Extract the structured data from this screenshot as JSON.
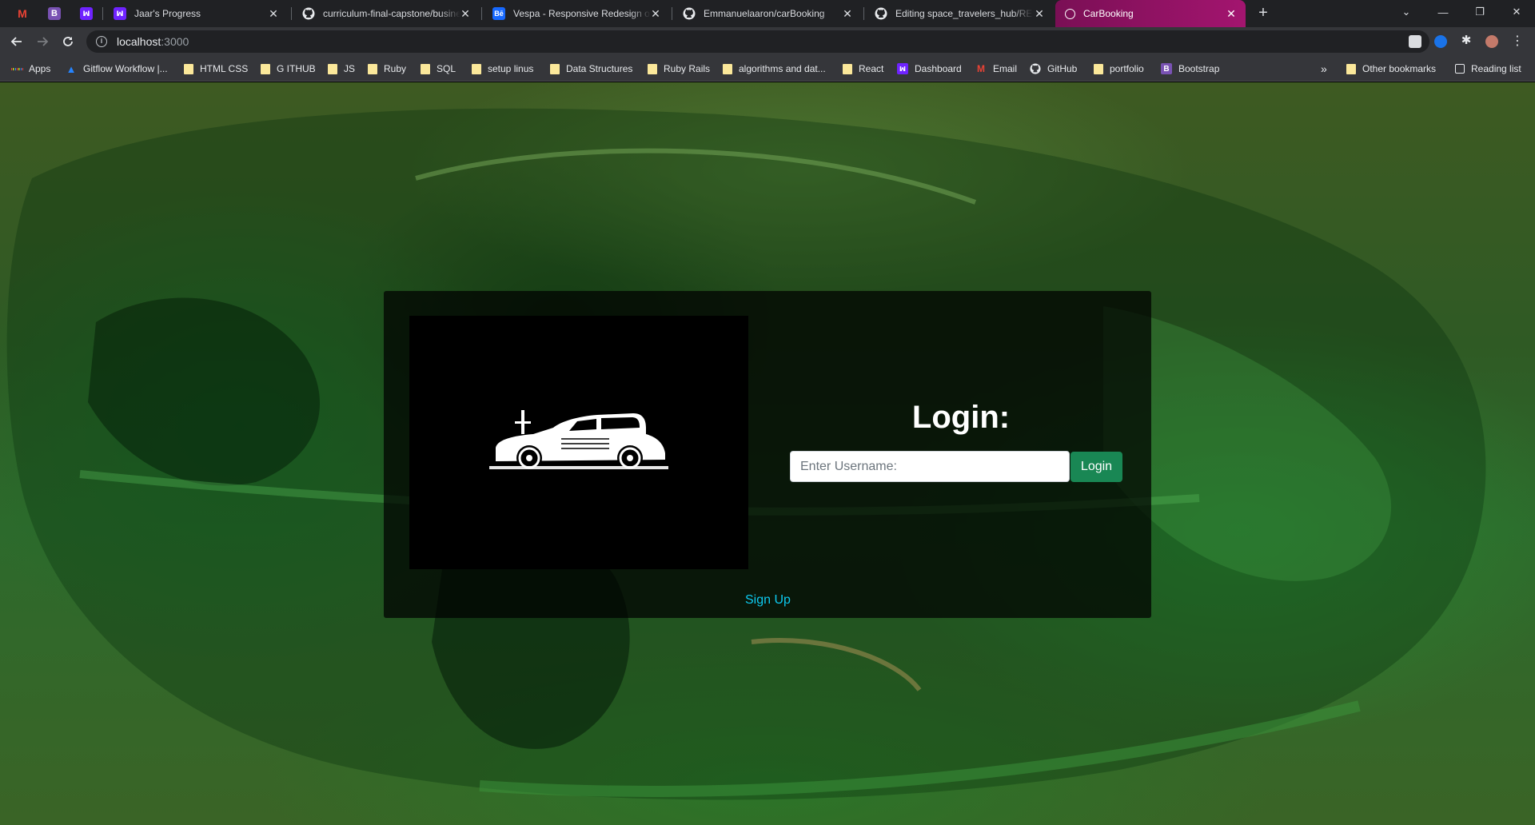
{
  "browser": {
    "tabs": [
      {
        "label": "",
        "favicon": "gmail-icon",
        "pinned": true
      },
      {
        "label": "",
        "favicon": "bootstrap-icon",
        "pinned": true
      },
      {
        "label": "",
        "favicon": "microverse-icon",
        "pinned": true
      },
      {
        "label": "Jaar's Progress",
        "favicon": "microverse-icon"
      },
      {
        "label": "curriculum-final-capstone/busine",
        "favicon": "github-icon"
      },
      {
        "label": "Vespa - Responsive Redesign on",
        "favicon": "behance-icon"
      },
      {
        "label": "Emmanuelaaron/carBooking",
        "favicon": "github-icon"
      },
      {
        "label": "Editing space_travelers_hub/REA",
        "favicon": "github-icon"
      },
      {
        "label": "CarBooking",
        "favicon": "globe-icon",
        "active": true
      }
    ],
    "address": {
      "host": "localhost",
      "port": ":3000"
    },
    "bookmarks": [
      {
        "label": "Apps",
        "icon": "apps-grid-icon"
      },
      {
        "label": "Gitflow Workflow |...",
        "icon": "atlassian-icon"
      },
      {
        "label": "HTML CSS",
        "icon": "folder-icon"
      },
      {
        "label": "G ITHUB",
        "icon": "folder-icon"
      },
      {
        "label": "JS",
        "icon": "folder-icon"
      },
      {
        "label": "Ruby",
        "icon": "folder-icon"
      },
      {
        "label": "SQL",
        "icon": "folder-icon"
      },
      {
        "label": "setup linus",
        "icon": "folder-icon"
      },
      {
        "label": "Data Structures",
        "icon": "folder-icon"
      },
      {
        "label": "Ruby Rails",
        "icon": "folder-icon"
      },
      {
        "label": "algorithms and dat...",
        "icon": "folder-icon"
      },
      {
        "label": "React",
        "icon": "folder-icon"
      },
      {
        "label": "Dashboard",
        "icon": "microverse-icon"
      },
      {
        "label": "Email",
        "icon": "gmail-icon"
      },
      {
        "label": "GitHub",
        "icon": "github-icon"
      },
      {
        "label": "portfolio",
        "icon": "folder-icon"
      },
      {
        "label": "Bootstrap",
        "icon": "bootstrap-icon"
      }
    ],
    "other_bookmarks": "Other bookmarks",
    "reading_list": "Reading list",
    "overflow": "»"
  },
  "page": {
    "title": "Login:",
    "username_placeholder": "Enter Username:",
    "username_value": "",
    "login_button": "Login",
    "signup_link": "Sign Up",
    "logo": "vintage-car-logo"
  },
  "colors": {
    "active_tab": "#a3156f",
    "login_button": "#198754",
    "signup_link": "#0dcaf0",
    "overlay_tint": "#2d6a2c"
  }
}
